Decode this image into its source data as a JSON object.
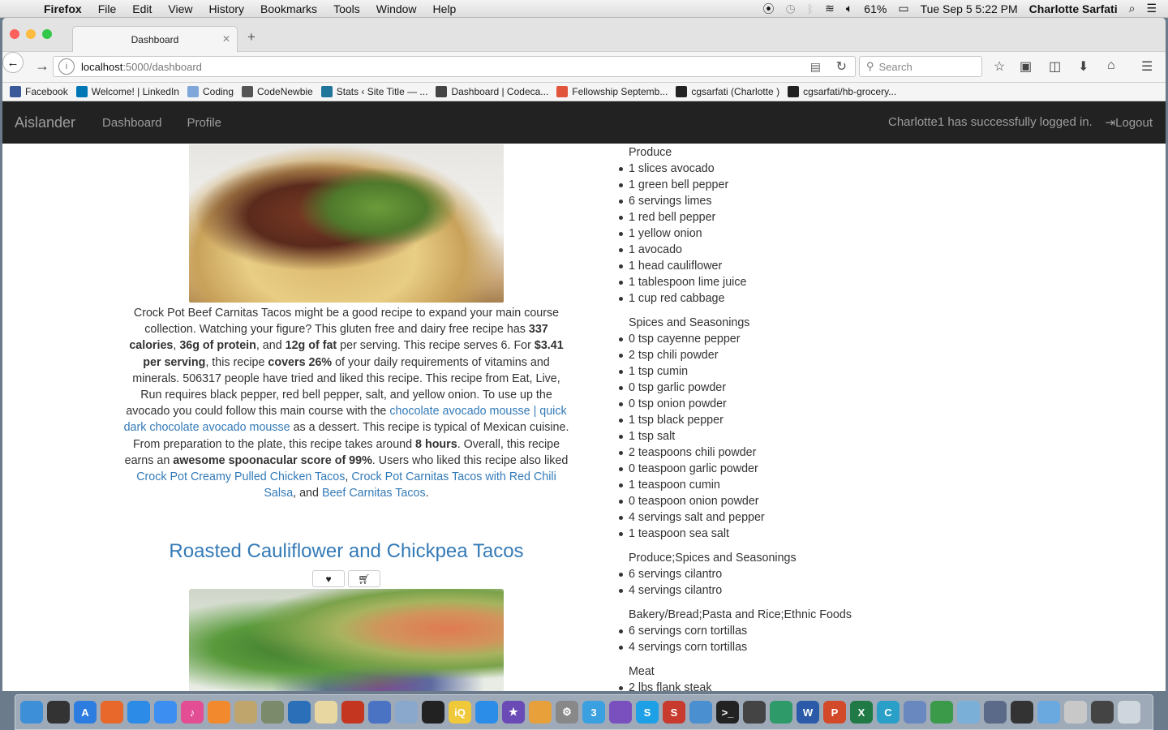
{
  "menubar": {
    "app": "Firefox",
    "items": [
      "File",
      "Edit",
      "View",
      "History",
      "Bookmarks",
      "Tools",
      "Window",
      "Help"
    ],
    "battery": "61%",
    "clock": "Tue Sep 5  5:22 PM",
    "user": "Charlotte Sarfati"
  },
  "browser": {
    "tab_title": "Dashboard",
    "url_host": "localhost",
    "url_path": ":5000/dashboard",
    "search_placeholder": "Search",
    "bookmarks": [
      {
        "label": "Facebook",
        "icon": "facebook-icon",
        "color": "#3b5998"
      },
      {
        "label": "Welcome! | LinkedIn",
        "icon": "linkedin-icon",
        "color": "#0077b5"
      },
      {
        "label": "Coding",
        "icon": "folder-icon",
        "color": "#7fa7d9"
      },
      {
        "label": "CodeNewbie",
        "icon": "codenewbie-icon",
        "color": "#555555"
      },
      {
        "label": "Stats ‹ Site Title — ...",
        "icon": "wordpress-icon",
        "color": "#21759b"
      },
      {
        "label": "Dashboard | Codeca...",
        "icon": "codecademy-icon",
        "color": "#444444"
      },
      {
        "label": "Fellowship Septemb...",
        "icon": "fellowship-icon",
        "color": "#e2553d"
      },
      {
        "label": "cgsarfati (Charlotte )",
        "icon": "github-icon",
        "color": "#222222"
      },
      {
        "label": "cgsarfati/hb-grocery...",
        "icon": "github-icon",
        "color": "#222222"
      }
    ]
  },
  "app_nav": {
    "brand": "Aislander",
    "links": [
      "Dashboard",
      "Profile"
    ],
    "login_message": "Charlotte1 has successfully logged in.",
    "logout": "Logout"
  },
  "recipe1": {
    "desc": [
      {
        "t": "Crock Pot Beef Carnitas Tacos might be a good recipe to expand your main course collection. Watching your figure? This gluten free and dairy free recipe has "
      },
      {
        "t": "337 calories",
        "b": true
      },
      {
        "t": ", "
      },
      {
        "t": "36g of protein",
        "b": true
      },
      {
        "t": ", and "
      },
      {
        "t": "12g of fat",
        "b": true
      },
      {
        "t": " per serving. This recipe serves 6. For "
      },
      {
        "t": "$3.41 per serving",
        "b": true
      },
      {
        "t": ", this recipe "
      },
      {
        "t": "covers 26%",
        "b": true
      },
      {
        "t": " of your daily requirements of vitamins and minerals. 506317 people have tried and liked this recipe. This recipe from Eat, Live, Run requires black pepper, red bell pepper, salt, and yellow onion. To use up the avocado you could follow this main course with the "
      },
      {
        "t": "chocolate avocado mousse | quick dark chocolate avocado mousse",
        "a": true
      },
      {
        "t": " as a dessert. This recipe is typical of Mexican cuisine. From preparation to the plate, this recipe takes around "
      },
      {
        "t": "8 hours",
        "b": true
      },
      {
        "t": ". Overall, this recipe earns an "
      },
      {
        "t": "awesome spoonacular score of 99%",
        "b": true
      },
      {
        "t": ". Users who liked this recipe also liked "
      },
      {
        "t": "Crock Pot Creamy Pulled Chicken Tacos",
        "a": true
      },
      {
        "t": ", "
      },
      {
        "t": "Crock Pot Carnitas Tacos with Red Chili Salsa",
        "a": true
      },
      {
        "t": ", and "
      },
      {
        "t": "Beef Carnitas Tacos",
        "a": true
      },
      {
        "t": "."
      }
    ]
  },
  "recipe2": {
    "title": "Roasted Cauliflower and Chickpea Tacos"
  },
  "shopping_list": [
    {
      "category": "Produce",
      "items": [
        "1 slices avocado",
        "1 green bell pepper",
        "6 servings limes",
        "1 red bell pepper",
        "1 yellow onion",
        "1 avocado",
        "1 head cauliflower",
        "1 tablespoon lime juice",
        "1 cup red cabbage"
      ]
    },
    {
      "category": "Spices and Seasonings",
      "items": [
        "0 tsp cayenne pepper",
        "2 tsp chili powder",
        "1 tsp cumin",
        "0 tsp garlic powder",
        "0 tsp onion powder",
        "1 tsp black pepper",
        "1 tsp salt",
        "2 teaspoons chili powder",
        "0 teaspoon garlic powder",
        "1 teaspoon cumin",
        "0 teaspoon onion powder",
        "4 servings salt and pepper",
        "1 teaspoon sea salt"
      ]
    },
    {
      "category": "Produce;Spices and Seasonings",
      "items": [
        "6 servings cilantro",
        "4 servings cilantro"
      ]
    },
    {
      "category": "Bakery/Bread;Pasta and Rice;Ethnic Foods",
      "items": [
        "6 servings corn tortillas",
        "4 servings corn tortillas"
      ]
    },
    {
      "category": "Meat",
      "items": [
        "2 lbs flank steak"
      ]
    }
  ],
  "dock": [
    {
      "icon": "finder-icon",
      "color": "#3d8fd8",
      "glyph": ""
    },
    {
      "icon": "launchpad-icon",
      "color": "#333",
      "glyph": ""
    },
    {
      "icon": "app-store-icon",
      "color": "#2d7de0",
      "glyph": "A"
    },
    {
      "icon": "firefox-icon",
      "color": "#e8672a",
      "glyph": ""
    },
    {
      "icon": "safari-icon",
      "color": "#2b8be6",
      "glyph": ""
    },
    {
      "icon": "messages-icon",
      "color": "#3c8ff0",
      "glyph": ""
    },
    {
      "icon": "itunes-icon",
      "color": "#e34d93",
      "glyph": "♪"
    },
    {
      "icon": "ibooks-icon",
      "color": "#f2892c",
      "glyph": ""
    },
    {
      "icon": "preview-icon",
      "color": "#bfa56c",
      "glyph": ""
    },
    {
      "icon": "photo-icon",
      "color": "#7a8a6a",
      "glyph": ""
    },
    {
      "icon": "camino-icon",
      "color": "#2a6fb8",
      "glyph": ""
    },
    {
      "icon": "notes-icon",
      "color": "#e8d7a0",
      "glyph": ""
    },
    {
      "icon": "photo-booth-icon",
      "color": "#c4361f",
      "glyph": ""
    },
    {
      "icon": "xcode-icon",
      "color": "#4a73c4",
      "glyph": ""
    },
    {
      "icon": "mail-icon",
      "color": "#8aa8cc",
      "glyph": ""
    },
    {
      "icon": "radiation-icon",
      "color": "#222",
      "glyph": ""
    },
    {
      "icon": "iq-icon",
      "color": "#f0c93a",
      "glyph": "iQ"
    },
    {
      "icon": "dropbox-icon",
      "color": "#2c8de8",
      "glyph": ""
    },
    {
      "icon": "imovie-icon",
      "color": "#6a4ab5",
      "glyph": "★"
    },
    {
      "icon": "photos-icon",
      "color": "#e8a13a",
      "glyph": ""
    },
    {
      "icon": "system-preferences-icon",
      "color": "#888",
      "glyph": "⚙"
    },
    {
      "icon": "app-3-icon",
      "color": "#3aa0e0",
      "glyph": "3"
    },
    {
      "icon": "viber-icon",
      "color": "#7a4fbe",
      "glyph": ""
    },
    {
      "icon": "skype-icon",
      "color": "#1ea0e6",
      "glyph": "S"
    },
    {
      "icon": "scrivener-icon",
      "color": "#c83a2e",
      "glyph": "S"
    },
    {
      "icon": "network-icon",
      "color": "#4a8fd0",
      "glyph": ""
    },
    {
      "icon": "terminal-icon",
      "color": "#222",
      "glyph": ">_"
    },
    {
      "icon": "console-icon",
      "color": "#444",
      "glyph": ""
    },
    {
      "icon": "atom-icon",
      "color": "#2e9a6a",
      "glyph": ""
    },
    {
      "icon": "word-icon",
      "color": "#2b5aa8",
      "glyph": "W"
    },
    {
      "icon": "powerpoint-icon",
      "color": "#d24a2a",
      "glyph": "P"
    },
    {
      "icon": "excel-icon",
      "color": "#1f7a45",
      "glyph": "X"
    },
    {
      "icon": "c-app-icon",
      "color": "#2aa0c8",
      "glyph": "C"
    },
    {
      "icon": "keynote-icon",
      "color": "#6a88c0",
      "glyph": ""
    },
    {
      "icon": "numbers-icon",
      "color": "#3a9a4a",
      "glyph": ""
    },
    {
      "icon": "preview-2-icon",
      "color": "#7ab0d8",
      "glyph": ""
    },
    {
      "icon": "grapher-icon",
      "color": "#5a6a88",
      "glyph": ""
    },
    {
      "icon": "printer-icon",
      "color": "#333",
      "glyph": ""
    },
    {
      "icon": "folder-icon",
      "color": "#6aa8e0",
      "glyph": ""
    },
    {
      "icon": "documents-icon",
      "color": "#c8c8c8",
      "glyph": ""
    },
    {
      "icon": "downloads-icon",
      "color": "#444",
      "glyph": ""
    },
    {
      "icon": "trash-icon",
      "color": "#d0d6de",
      "glyph": ""
    }
  ]
}
